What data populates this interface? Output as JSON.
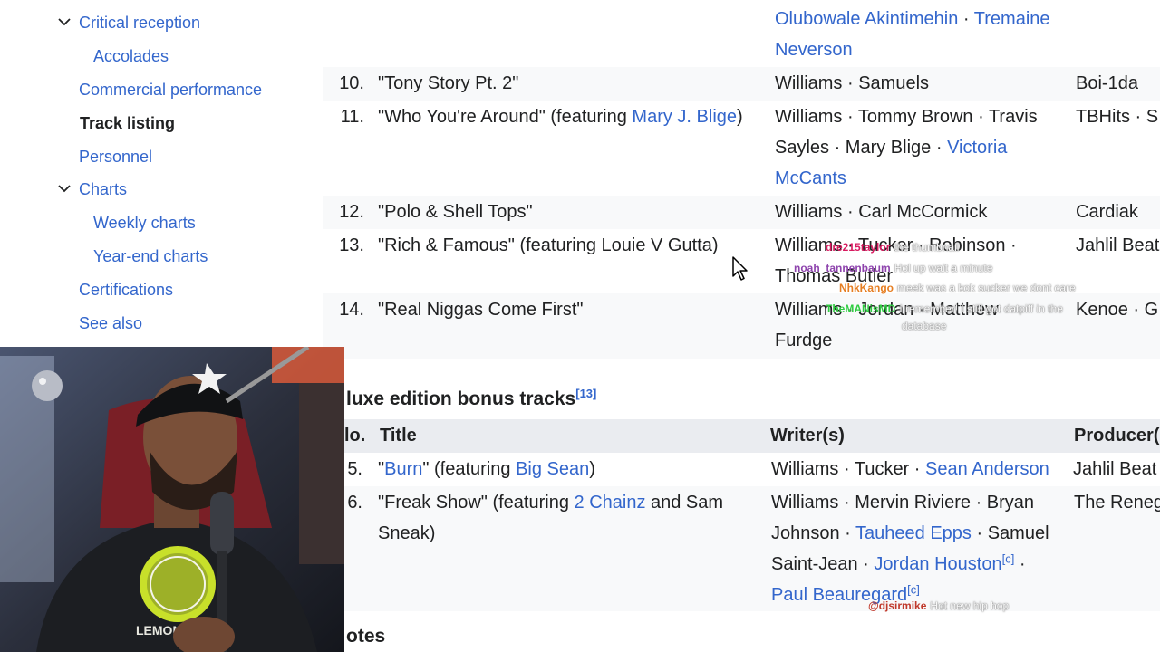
{
  "toc": {
    "items": [
      {
        "label": "Critical reception",
        "toggle": true
      },
      {
        "label": "Accolades",
        "sub": true
      },
      {
        "label": "Commercial performance"
      },
      {
        "label": "Track listing",
        "current": true
      },
      {
        "label": "Personnel"
      },
      {
        "label": "Charts",
        "toggle": true
      },
      {
        "label": "Weekly charts",
        "sub": true
      },
      {
        "label": "Year-end charts",
        "sub": true
      },
      {
        "label": "Certifications"
      },
      {
        "label": "See also"
      }
    ]
  },
  "standard_tracks": {
    "row9_writers_tail": [
      "Olubowale Akintimehin",
      "·",
      "Tremaine",
      "Neverson"
    ],
    "rows": [
      {
        "no": "10.",
        "title": "\"Tony Story Pt. 2\"",
        "writers_line1": "Williams · Samuels",
        "producer": "Boi-1da"
      },
      {
        "no": "11.",
        "title_start": "\"Who You're Around\" (featuring ",
        "title_link": "Mary J. Blige",
        "title_end": ")",
        "writers_line1": "Williams · Tommy Brown · Travis",
        "writers_line2_plain": "Sayles · Mary Blige · ",
        "writers_line2_link": "Victoria",
        "writers_line3_link": "McCants",
        "producer": "TBHits · S"
      },
      {
        "no": "12.",
        "title": "\"Polo & Shell Tops\"",
        "writers_line1": "Williams · Carl McCormick",
        "producer": "Cardiak"
      },
      {
        "no": "13.",
        "title": "\"Rich & Famous\" (featuring Louie V Gutta)",
        "writers_line1": "Williams · Tucker · Robinson ·",
        "writers_line2": "Thomas Butler",
        "producer": "Jahlil Beat"
      },
      {
        "no": "14.",
        "title": "\"Real Niggas Come First\"",
        "writers_line1": "Williams · Jordan · Matthew",
        "writers_line2": "Furdge",
        "producer": "Kenoe · G"
      }
    ]
  },
  "deluxe": {
    "heading": "luxe edition bonus tracks",
    "heading_ref": "[13]",
    "columns": {
      "no": "lo.",
      "title": "Title",
      "writers": "Writer(s)",
      "producer": "Producer("
    },
    "rows": [
      {
        "no": "5.",
        "title_q1": "\"",
        "title_link": "Burn",
        "title_mid": "\" (featuring ",
        "title_feat": "Big Sean",
        "title_end": ")",
        "writers_plain": "Williams · Tucker · ",
        "writers_link": "Sean Anderson",
        "producer": "Jahlil Beat"
      },
      {
        "no": "6.",
        "title_line1_start": "\"Freak Show\" (featuring ",
        "title_link": "2 Chainz",
        "title_line1_end": " and Sam",
        "title_line2": "Sneak)",
        "writers_line1": "Williams · Mervin Riviere · Bryan",
        "writers_line2_plain": "Johnson · ",
        "writers_line2_link": "Tauheed Epps",
        "writers_line2_end": " · Samuel",
        "writers_line3_plain": "Saint-Jean · ",
        "writers_line3_link": "Jordan Houston",
        "writers_line3_ref": "[c]",
        "writers_line3_end": " ·",
        "writers_line4_link": "Paul Beauregard",
        "writers_line4_ref": "[c]",
        "producer": "The Reneg"
      }
    ],
    "next_heading": "otes"
  },
  "chat": [
    {
      "user": "dre215taylor",
      "msg": "the thumbnail",
      "user_color": "#d81b60"
    },
    {
      "user": "noah_tannenbaum",
      "msg": "Hol up wait a minute",
      "user_color": "#8e44ad"
    },
    {
      "user": "NhkKango",
      "msg": "meek was a kok sucker we dont care",
      "user_color": "#e67e22"
    },
    {
      "user": "TheMANisMD",
      "msg": "I remember! I still got datpiff in the",
      "user_color": "#2ecc40"
    },
    {
      "user": "",
      "msg": "database",
      "user_color": "#2ecc40"
    },
    {
      "user": "@djsirmike",
      "msg": "Hot new hip hop",
      "user_color": "#c0392b"
    }
  ],
  "webcam": {
    "shirt_text": "LEMONADE"
  },
  "colors": {
    "link": "#3366cc",
    "text": "#202122",
    "stripe": "#f8f9fa",
    "header_bg": "#eaecf0"
  }
}
